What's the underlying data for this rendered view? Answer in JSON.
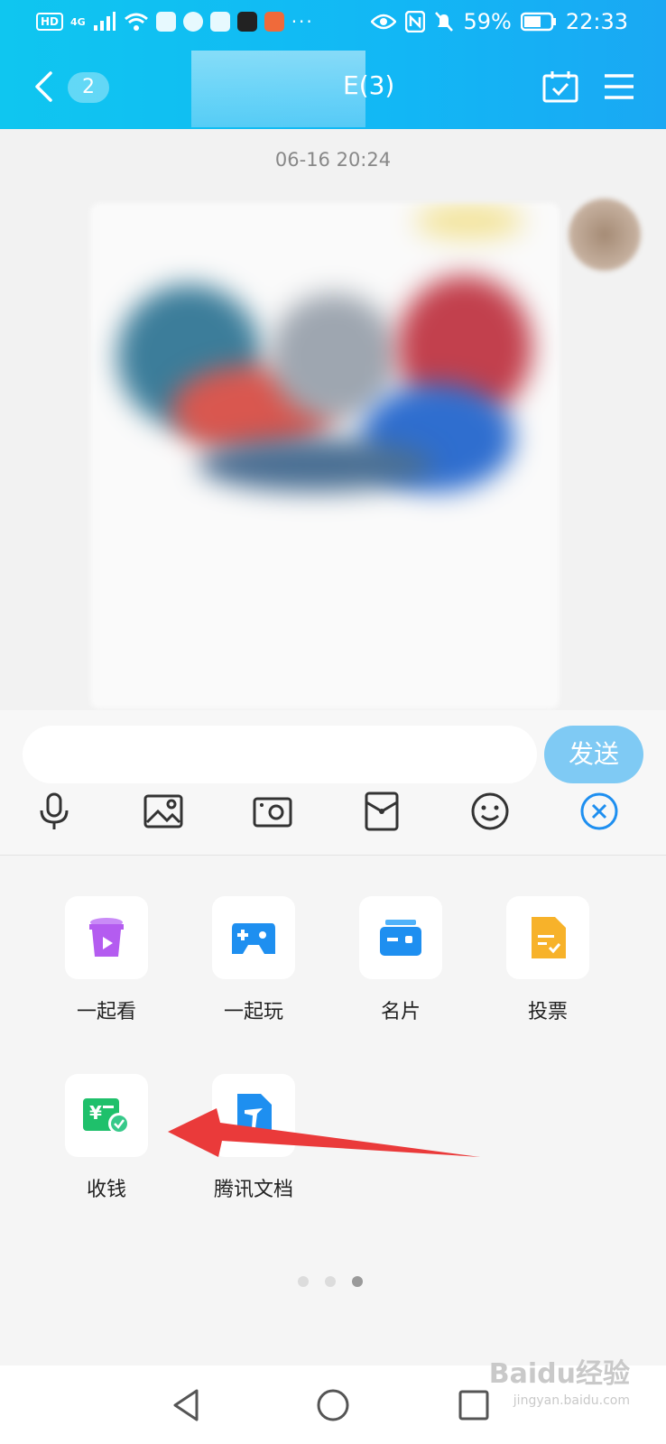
{
  "status_bar": {
    "hd": "HD",
    "network": "4G",
    "battery": "59%",
    "time": "22:33",
    "more": "···"
  },
  "header": {
    "unread_count": "2",
    "title_visible_suffix": "E(3)"
  },
  "chat": {
    "timestamp": "06-16 20:24"
  },
  "composer": {
    "input_value": "",
    "send_label": "发送",
    "tools": [
      "microphone-icon",
      "image-icon",
      "camera-icon",
      "red-packet-icon",
      "emoji-icon",
      "close-panel-icon"
    ]
  },
  "apps": [
    {
      "label": "一起看",
      "icon": "watch-together-icon",
      "color": "#b45cf0"
    },
    {
      "label": "一起玩",
      "icon": "gamepad-icon",
      "color": "#1e8ff0"
    },
    {
      "label": "名片",
      "icon": "business-card-icon",
      "color": "#1e8ff0"
    },
    {
      "label": "投票",
      "icon": "vote-icon",
      "color": "#f7b22a"
    },
    {
      "label": "收钱",
      "icon": "receive-money-icon",
      "color": "#1fc06b"
    },
    {
      "label": "腾讯文档",
      "icon": "tencent-docs-icon",
      "color": "#1e8ff0"
    }
  ],
  "pager": {
    "pages": 3,
    "active": 3
  },
  "watermark": {
    "text": "Baidu经验",
    "sub": "jingyan.baidu.com"
  }
}
